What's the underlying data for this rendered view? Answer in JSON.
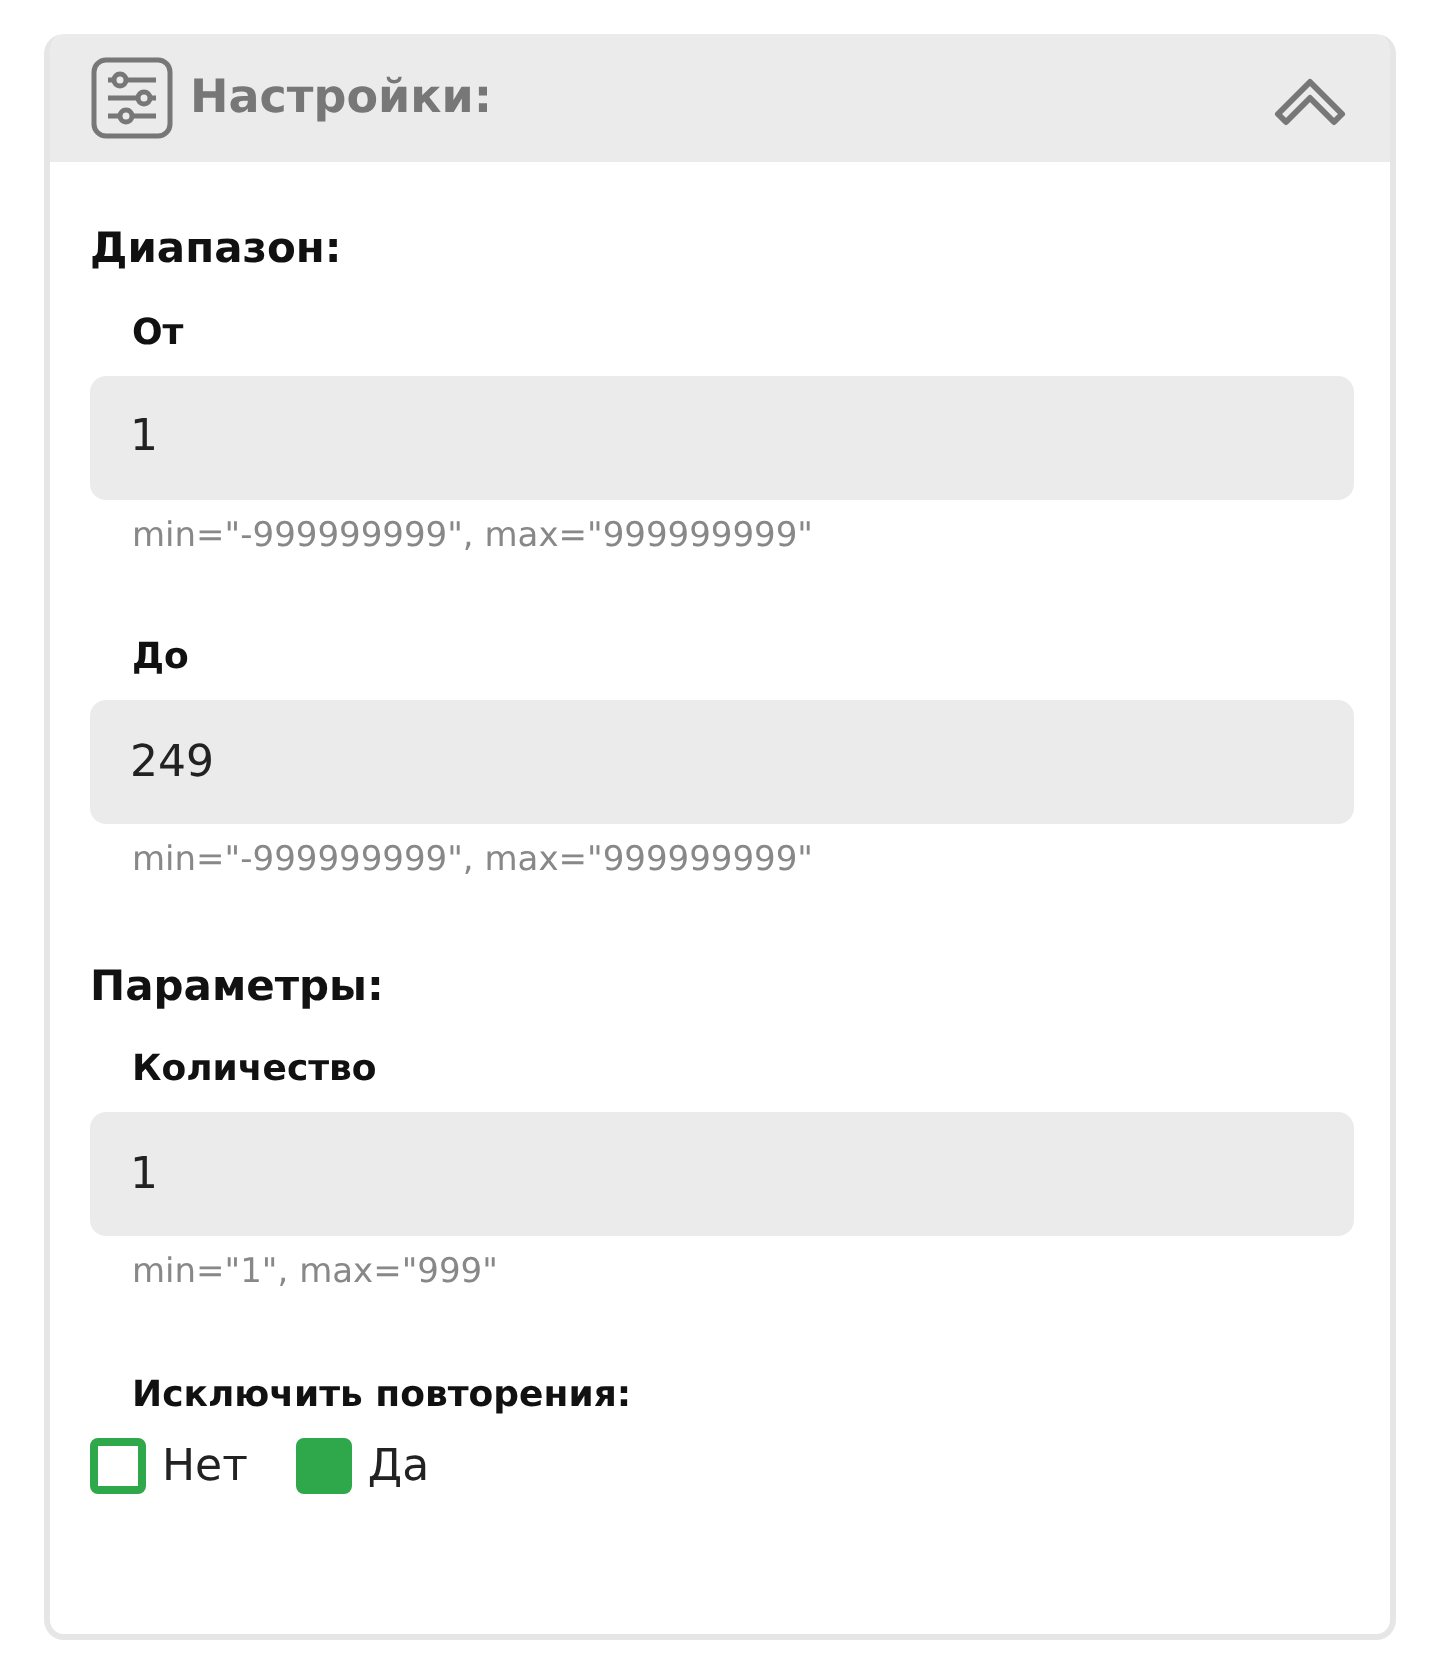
{
  "panel": {
    "title": "Настройки:",
    "expanded": true
  },
  "sections": [
    {
      "title": "Диапазон:",
      "fields": [
        {
          "kind": "number",
          "label": "От",
          "value": "1",
          "hint": "min=\"-999999999\", max=\"999999999\""
        },
        {
          "kind": "number",
          "label": "До",
          "value": "249",
          "hint": "min=\"-999999999\", max=\"999999999\""
        }
      ]
    },
    {
      "title": "Параметры:",
      "fields": [
        {
          "kind": "number",
          "label": "Количество",
          "value": "1",
          "hint": "min=\"1\", max=\"999\""
        },
        {
          "kind": "choice",
          "label": "Исключить повторения:",
          "options": [
            {
              "label": "Нет",
              "selected": false
            },
            {
              "label": "Да",
              "selected": true
            }
          ]
        }
      ]
    }
  ]
}
